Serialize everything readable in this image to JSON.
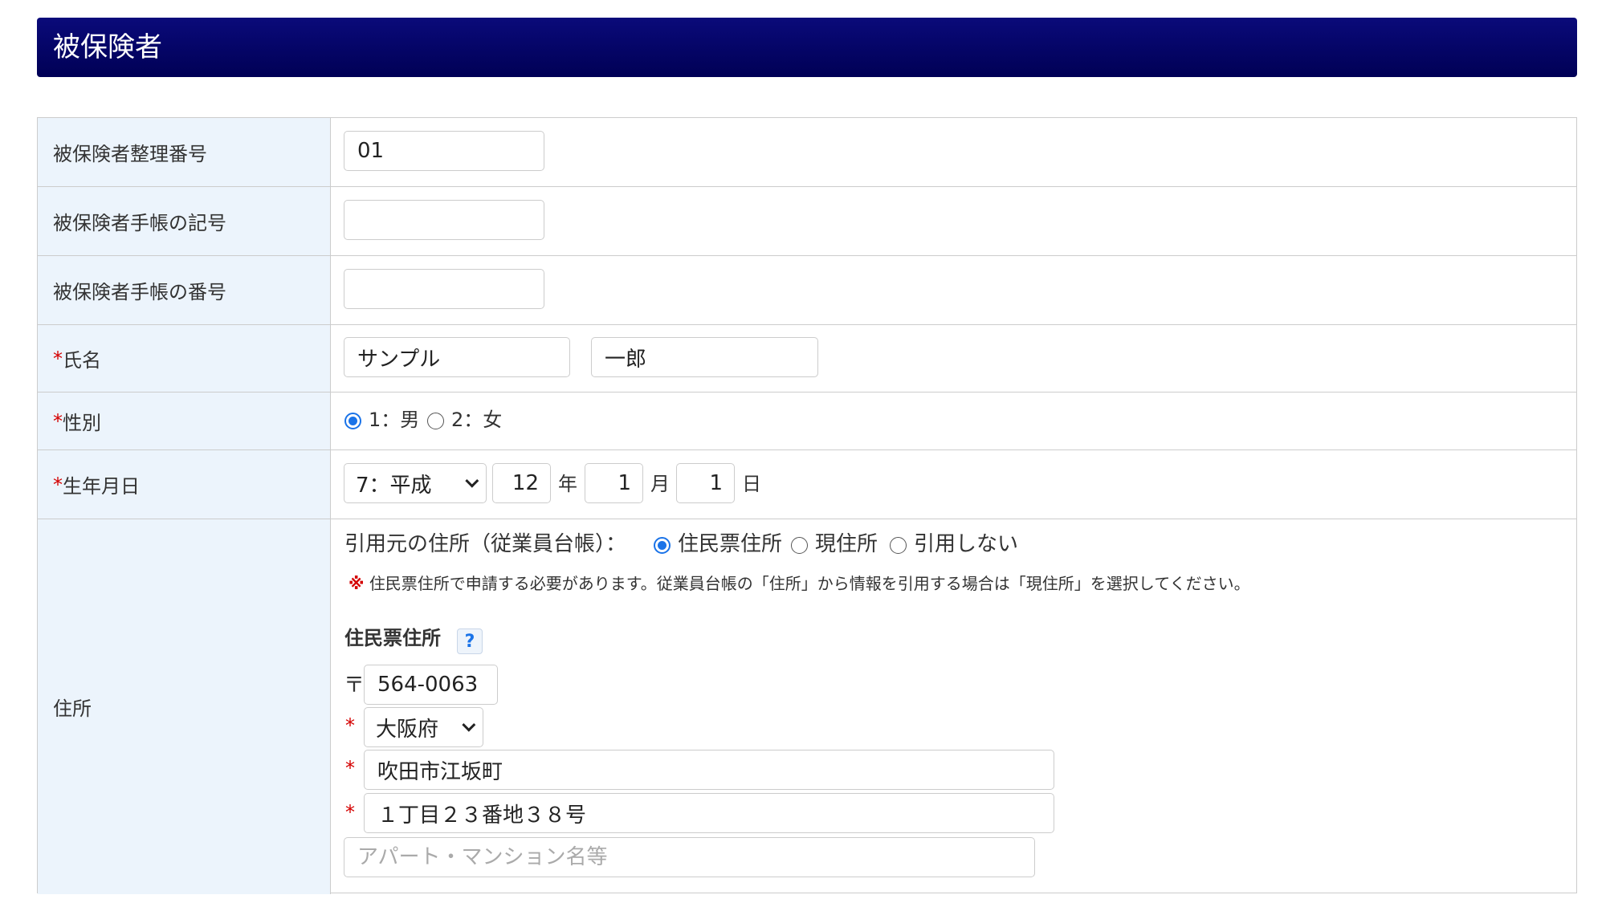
{
  "header": {
    "title": "被保険者"
  },
  "rows": {
    "insured_number": {
      "label": "被保険者整理番号",
      "value": "01"
    },
    "booklet_symbol": {
      "label": "被保険者手帳の記号",
      "value": ""
    },
    "booklet_number": {
      "label": "被保険者手帳の番号",
      "value": ""
    },
    "name": {
      "required_mark": "*",
      "label": "氏名",
      "last_name": "サンプル",
      "first_name": "一郎"
    },
    "gender": {
      "required_mark": "*",
      "label": "性別",
      "options": [
        "1：男",
        "2：女"
      ],
      "selected": "1：男"
    },
    "birthdate": {
      "required_mark": "*",
      "label": "生年月日",
      "era": "7：平成",
      "year": "12",
      "year_unit": "年",
      "month": "1",
      "month_unit": "月",
      "day": "1",
      "day_unit": "日"
    },
    "address": {
      "label": "住所",
      "source_label": "引用元の住所（従業員台帳）：",
      "source_options": [
        "住民票住所",
        "現住所",
        "引用しない"
      ],
      "source_selected": "住民票住所",
      "note_mark": "※",
      "note": "住民票住所で申請する必要があります。従業員台帳の「住所」から情報を引用する場合は「現住所」を選択してください。",
      "section_title": "住民票住所",
      "help_symbol": "?",
      "postal_mark": "〒",
      "postal_code": "564-0063",
      "required_mark": "*",
      "prefecture": "大阪府",
      "city": "吹田市江坂町",
      "street": "１丁目２３番地３８号",
      "building_placeholder": "アパート・マンション名等",
      "building": ""
    }
  },
  "colors": {
    "header_bg": "#00005a",
    "label_bg": "#ecf4fc",
    "required": "#d40000",
    "radio_selected": "#1a73e8"
  }
}
